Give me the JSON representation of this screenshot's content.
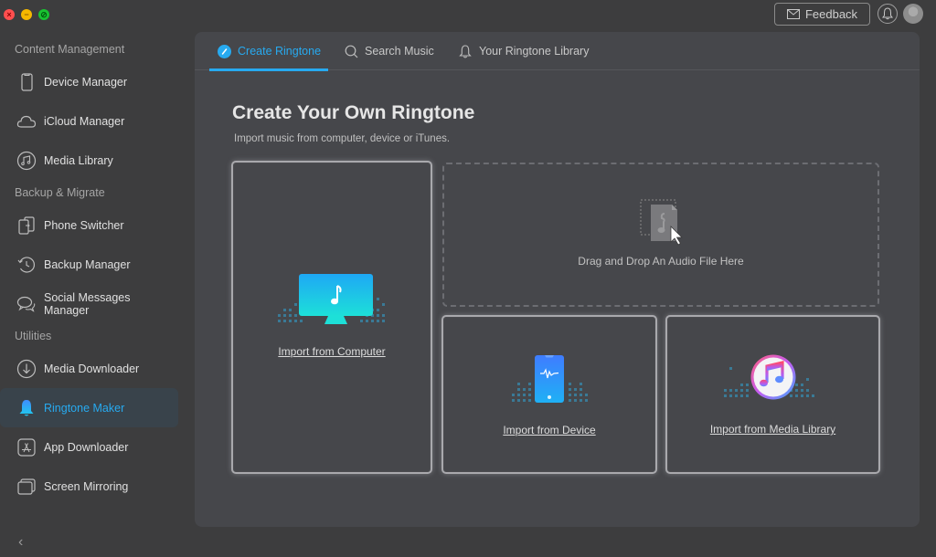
{
  "window": {
    "controls": [
      "close",
      "minimize",
      "maximize"
    ]
  },
  "topbar": {
    "feedback_label": "Feedback",
    "feedback_icon": "mail-icon",
    "notification_icon": "bell-icon",
    "avatar_icon": "user-avatar"
  },
  "sidebar": {
    "sections": [
      {
        "title": "Content Management",
        "items": [
          {
            "label": "Device Manager",
            "icon": "phone-icon"
          },
          {
            "label": "iCloud Manager",
            "icon": "cloud-icon"
          },
          {
            "label": "Media Library",
            "icon": "music-note-icon"
          }
        ]
      },
      {
        "title": "Backup & Migrate",
        "items": [
          {
            "label": "Phone Switcher",
            "icon": "phone-switch-icon"
          },
          {
            "label": "Backup Manager",
            "icon": "history-icon"
          },
          {
            "label": "Social Messages Manager",
            "icon": "chat-bubbles-icon"
          }
        ]
      },
      {
        "title": "Utilities",
        "items": [
          {
            "label": "Media Downloader",
            "icon": "download-icon"
          },
          {
            "label": "Ringtone Maker",
            "icon": "bell-icon",
            "active": true
          },
          {
            "label": "App Downloader",
            "icon": "app-store-icon"
          },
          {
            "label": "Screen Mirroring",
            "icon": "screens-icon"
          }
        ]
      }
    ],
    "collapse_icon": "chevron-left-icon",
    "collapse_glyph": "‹"
  },
  "tabs": [
    {
      "label": "Create Ringtone",
      "icon": "edit-circle-icon",
      "active": true
    },
    {
      "label": "Search Music",
      "icon": "search-icon"
    },
    {
      "label": "Your Ringtone Library",
      "icon": "bell-icon"
    }
  ],
  "main": {
    "title": "Create Your Own Ringtone",
    "subtitle": "Import music from computer, device or iTunes.",
    "dropzone_text": "Drag and Drop An Audio File Here",
    "cards": [
      {
        "label": "Import from Computer",
        "icon": "monitor-music-icon"
      },
      {
        "label": "Import from Device",
        "icon": "phone-waveform-icon"
      },
      {
        "label": "Import from Media Library",
        "icon": "itunes-icon"
      }
    ]
  },
  "colors": {
    "accent": "#27aaf0",
    "background": "#3d3d3e",
    "panel": "#46474b"
  }
}
